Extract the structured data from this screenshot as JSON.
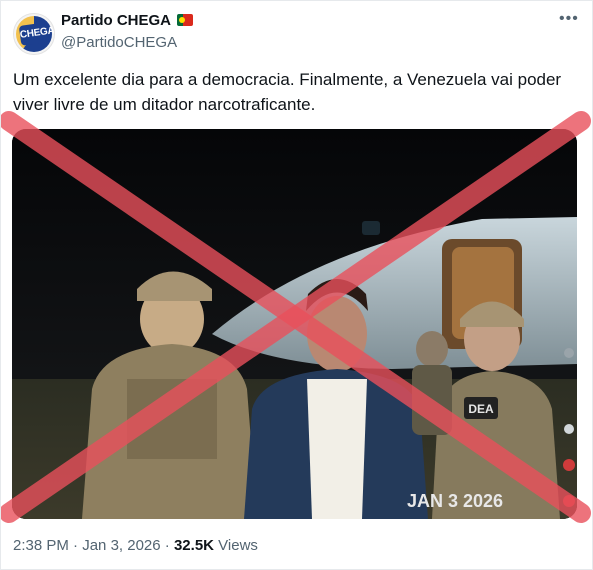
{
  "account": {
    "name": "Partido CHEGA",
    "handle": "@PartidoCHEGA",
    "avatar_text": "CHEGA",
    "flag": "portugal-flag-icon"
  },
  "menu": {
    "more_label": "•••"
  },
  "tweet": {
    "text": "Um excelente dia para a democracia. Finalmente, a Venezuela vai poder viver livre de um ditador narcotraficante."
  },
  "media": {
    "date_stamp": "JAN 3 2026",
    "patch_label": "DEA",
    "overlay": "red-x-cross",
    "overlay_color": "#e8505b"
  },
  "meta": {
    "time": "2:38 PM",
    "separator": " · ",
    "date": "Jan 3, 2026",
    "views_count": "32.5K",
    "views_label": "Views"
  }
}
